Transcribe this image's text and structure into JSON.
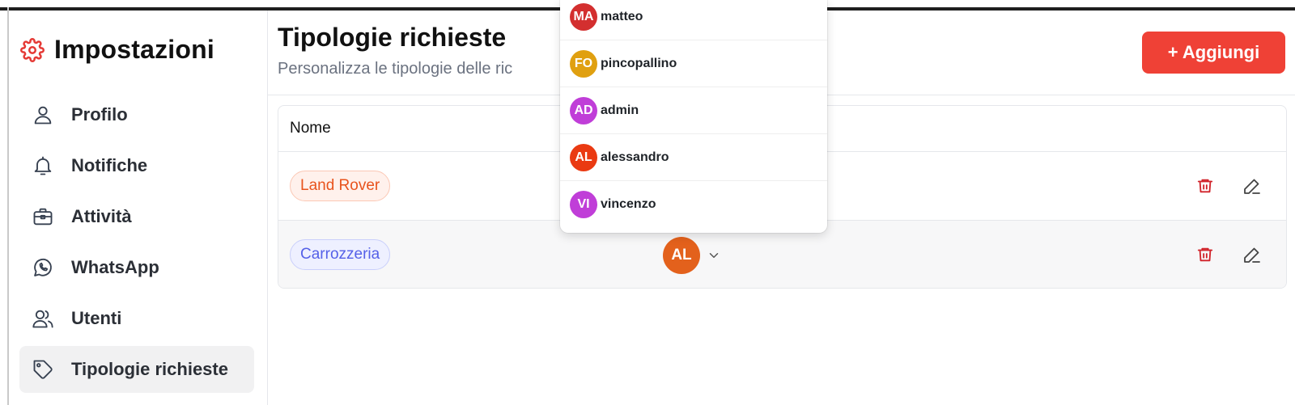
{
  "sidebar": {
    "title": "Impostazioni",
    "title_icon": "gear-icon",
    "accent_color": "#e53935",
    "items": [
      {
        "label": "Profilo",
        "icon": "user-icon",
        "active": false
      },
      {
        "label": "Notifiche",
        "icon": "bell-icon",
        "active": false
      },
      {
        "label": "Attività",
        "icon": "briefcase-icon",
        "active": false
      },
      {
        "label": "WhatsApp",
        "icon": "whatsapp-icon",
        "active": false
      },
      {
        "label": "Utenti",
        "icon": "users-icon",
        "active": false
      },
      {
        "label": "Tipologie richieste",
        "icon": "tag-icon",
        "active": true
      }
    ]
  },
  "main": {
    "title": "Tipologie richieste",
    "subtitle": "Personalizza le tipologie delle ric",
    "add_button_label": "+ Aggiungi",
    "add_button_color": "#ef4136",
    "table": {
      "header_name": "Nome",
      "rows": [
        {
          "name": "Land Rover",
          "tag_color": "orange"
        },
        {
          "name": "Carrozzeria",
          "tag_color": "blue",
          "assignee_initials": "AL",
          "assignee_color": "#e3611c"
        }
      ]
    }
  },
  "dropdown": {
    "users": [
      {
        "initials": "MA",
        "name": "matteo",
        "color": "#d32f2f"
      },
      {
        "initials": "FO",
        "name": "pincopallino",
        "color": "#e0a010"
      },
      {
        "initials": "AD",
        "name": "admin",
        "color": "#c03ed8"
      },
      {
        "initials": "AL",
        "name": "alessandro",
        "color": "#ea3a12"
      },
      {
        "initials": "VI",
        "name": "vincenzo",
        "color": "#c03ed8"
      }
    ]
  }
}
